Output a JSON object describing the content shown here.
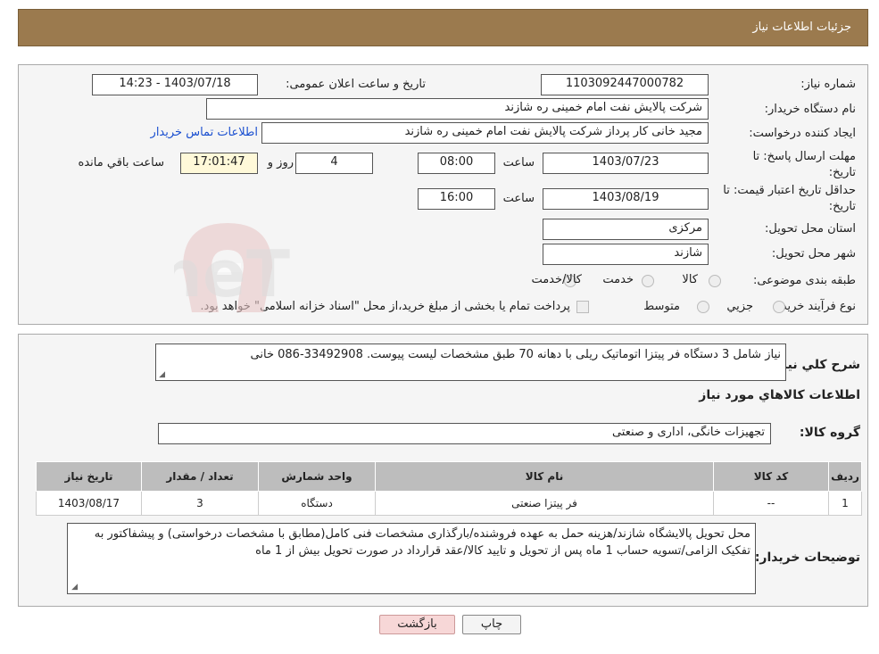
{
  "header": {
    "title": "جزئیات اطلاعات نیاز"
  },
  "form": {
    "need_number_label": "شماره نیاز:",
    "need_number": "1103092447000782",
    "announce_label": "تاریخ و ساعت اعلان عمومی:",
    "announce_value": "1403/07/18 - 14:23",
    "buyer_org_label": "نام دستگاه خریدار:",
    "buyer_org": "شرکت پالایش نفت امام خمینی  ره  شازند",
    "requester_label": "ایجاد کننده درخواست:",
    "requester": "مجید خانی کار پرداز شرکت پالایش نفت امام خمینی  ره  شازند",
    "contact_link": "اطلاعات تماس خریدار",
    "deadline_label": "مهلت ارسال پاسخ: تا تاریخ:",
    "deadline_date": "1403/07/23",
    "time_label": "ساعت",
    "deadline_time": "08:00",
    "days_value": "4",
    "days_label": "روز و",
    "remaining_time": "17:01:47",
    "remaining_label": "ساعت باقي مانده",
    "validity_label": "حداقل تاریخ اعتبار قیمت: تا تاریخ:",
    "validity_date": "1403/08/19",
    "validity_time": "16:00",
    "province_label": "استان محل تحویل:",
    "province": "مرکزی",
    "city_label": "شهر محل تحویل:",
    "city": "شازند",
    "category_label": "طبقه بندی موضوعی:",
    "category_options": [
      "کالا",
      "خدمت",
      "کالا/خدمت"
    ],
    "process_label": "نوع فرآیند خرید :",
    "process_options": [
      "جزیي",
      "متوسط"
    ],
    "payment_note": "پرداخت تمام یا بخشی از مبلغ خرید،از محل \"اسناد خزانه اسلامی\" خواهد بود."
  },
  "details": {
    "summary_label": "شرح كلي نياز:",
    "summary": "نیاز شامل 3 دستگاه فر پیتزا اتوماتیک ریلی با دهانه 70 طبق مشخصات لیست پیوست. 33492908-086 خانی",
    "goods_info_title": "اطلاعات كالاهاي مورد نياز",
    "goods_group_label": "گروه کالا:",
    "goods_group": "تجهیزات خانگی، اداری و صنعتی",
    "table": {
      "headers": [
        "ردیف",
        "کد کالا",
        "نام کالا",
        "واحد شمارش",
        "تعداد / مقدار",
        "تاریخ نیاز"
      ],
      "rows": [
        [
          "1",
          "--",
          "فر پیتزا صنعتی",
          "دستگاه",
          "3",
          "1403/08/17"
        ]
      ]
    },
    "buyer_notes_label": "توضیحات خریدار:",
    "buyer_notes": "محل تحویل پالایشگاه شازند/هزینه حمل به عهده فروشنده/بارگذاری مشخصات فنی کامل(مطابق با مشخصات درخواستی) و پیشفاکتور به تفکیک الزامی/تسویه حساب 1 ماه پس از تحویل و تایید کالا/عقد قرارداد در صورت تحویل بیش از 1 ماه"
  },
  "buttons": {
    "print": "چاپ",
    "back": "بازگشت"
  },
  "watermark": {
    "text": "AriaTender.neT"
  },
  "colors": {
    "header_bg": "#9b7a4e",
    "back_btn_bg": "#f7d7d7",
    "print_btn_bg": "#f4f4f4"
  }
}
